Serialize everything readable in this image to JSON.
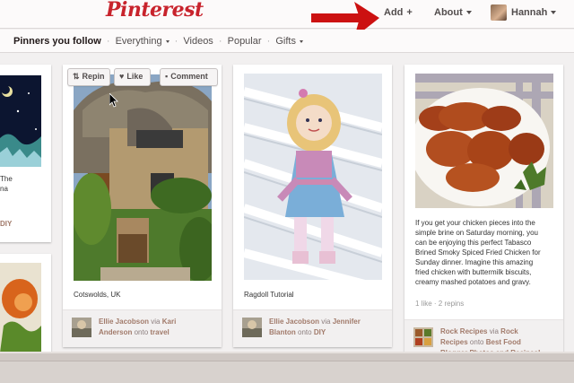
{
  "header": {
    "logo": "Pinterest",
    "add": "Add",
    "add_plus": "+",
    "about": "About",
    "user": "Hannah"
  },
  "subnav": {
    "items": [
      "Pinners you follow",
      "Everything",
      "Videos",
      "Popular",
      "Gifts"
    ]
  },
  "pin_actions": {
    "repin": "Repin",
    "like": "Like",
    "comment": "Comment"
  },
  "pins": {
    "left_cut": {
      "caption_line1": "The",
      "caption_line2": "na",
      "diy": "DIY"
    },
    "cotswolds": {
      "caption": "Cotswolds, UK",
      "pinner": "Ellie Jacobson",
      "via": "via",
      "source_line1": "Kari",
      "source_line2": "Anderson",
      "onto": "onto",
      "board": "travel"
    },
    "ragdoll": {
      "caption": "Ragdoll Tutorial",
      "pinner": "Ellie Jacobson",
      "via": "via",
      "source_line1": "Jennifer",
      "source_line2": "Blanton",
      "onto": "onto",
      "board": "DIY"
    },
    "chicken": {
      "caption_lines": [
        "If you get your chicken pieces into the",
        "simple brine on Saturday morning, you",
        "can be enjoying this perfect Tabasco",
        "Brined Smoky Spiced Fried Chicken for",
        "Sunday dinner. Imagine this amazing",
        "fried chicken with buttermilk biscuits,",
        "creamy mashed potatoes and gravy."
      ],
      "stats": "1 like · 2 repins",
      "pinner_line1": "Rock Recipes",
      "via": "via",
      "source_part1": "Rock",
      "source_part2": "Recipes",
      "onto": "onto",
      "board_line1": "Best Food",
      "board_line2": "Blogger Photos and Recipes!"
    }
  },
  "colors": {
    "brand_red": "#c8232c",
    "annotation_arrow": "#cc1111",
    "link_brown": "#a17a6a"
  }
}
